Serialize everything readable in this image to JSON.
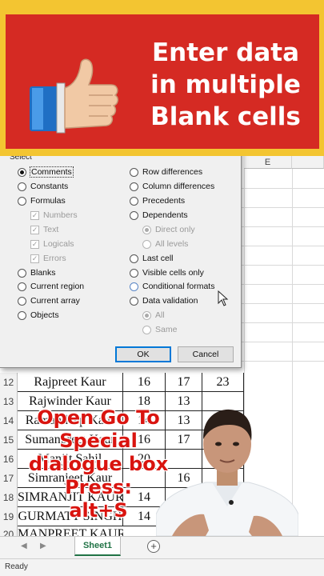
{
  "banner": {
    "lines": [
      "Enter data",
      "in multiple",
      "Blank cells"
    ],
    "icon": "thumbs-up-icon"
  },
  "sheet": {
    "col_e": "E",
    "rows": [
      {
        "num": "12",
        "name": "Rajpreet Kaur",
        "b": "16",
        "c": "17",
        "d": "23"
      },
      {
        "num": "13",
        "name": "Rajwinder Kaur",
        "b": "18",
        "c": "13",
        "d": ""
      },
      {
        "num": "14",
        "name": "Ramandeep Kaur",
        "b": "14",
        "c": "13",
        "d": ""
      },
      {
        "num": "15",
        "name": "Sumanpreet Kaur",
        "b": "16",
        "c": "17",
        "d": ""
      },
      {
        "num": "16",
        "name": "Manjit Sahil",
        "b": "20",
        "c": "",
        "d": ""
      },
      {
        "num": "17",
        "name": "Simranjeet Kaur",
        "b": "",
        "c": "16",
        "d": ""
      },
      {
        "num": "18",
        "name": "SIMRANJIT KAUR",
        "b": "14",
        "c": "",
        "d": ""
      },
      {
        "num": "19",
        "name": "GURMATT SINGH",
        "b": "14",
        "c": "",
        "d": ""
      },
      {
        "num": "20",
        "name": "MANPREET KAUR",
        "b": "",
        "c": "0",
        "d": "0"
      }
    ]
  },
  "dialog": {
    "title": "Select",
    "left": [
      "Comments",
      "Constants",
      "Formulas",
      "Numbers",
      "Text",
      "Logicals",
      "Errors",
      "Blanks",
      "Current region",
      "Current array",
      "Objects"
    ],
    "right": [
      "Row differences",
      "Column differences",
      "Precedents",
      "Dependents",
      "Direct only",
      "All levels",
      "Last cell",
      "Visible cells only",
      "Conditional formats",
      "Data validation",
      "All",
      "Same"
    ],
    "ok": "OK",
    "cancel": "Cancel"
  },
  "caption": {
    "lines": [
      "Open Go To",
      "Special",
      "dialogue box",
      "Press:",
      "alt+S"
    ]
  },
  "tabs": {
    "sheet1": "Sheet1",
    "add": "+"
  },
  "status": {
    "ready": "Ready"
  }
}
